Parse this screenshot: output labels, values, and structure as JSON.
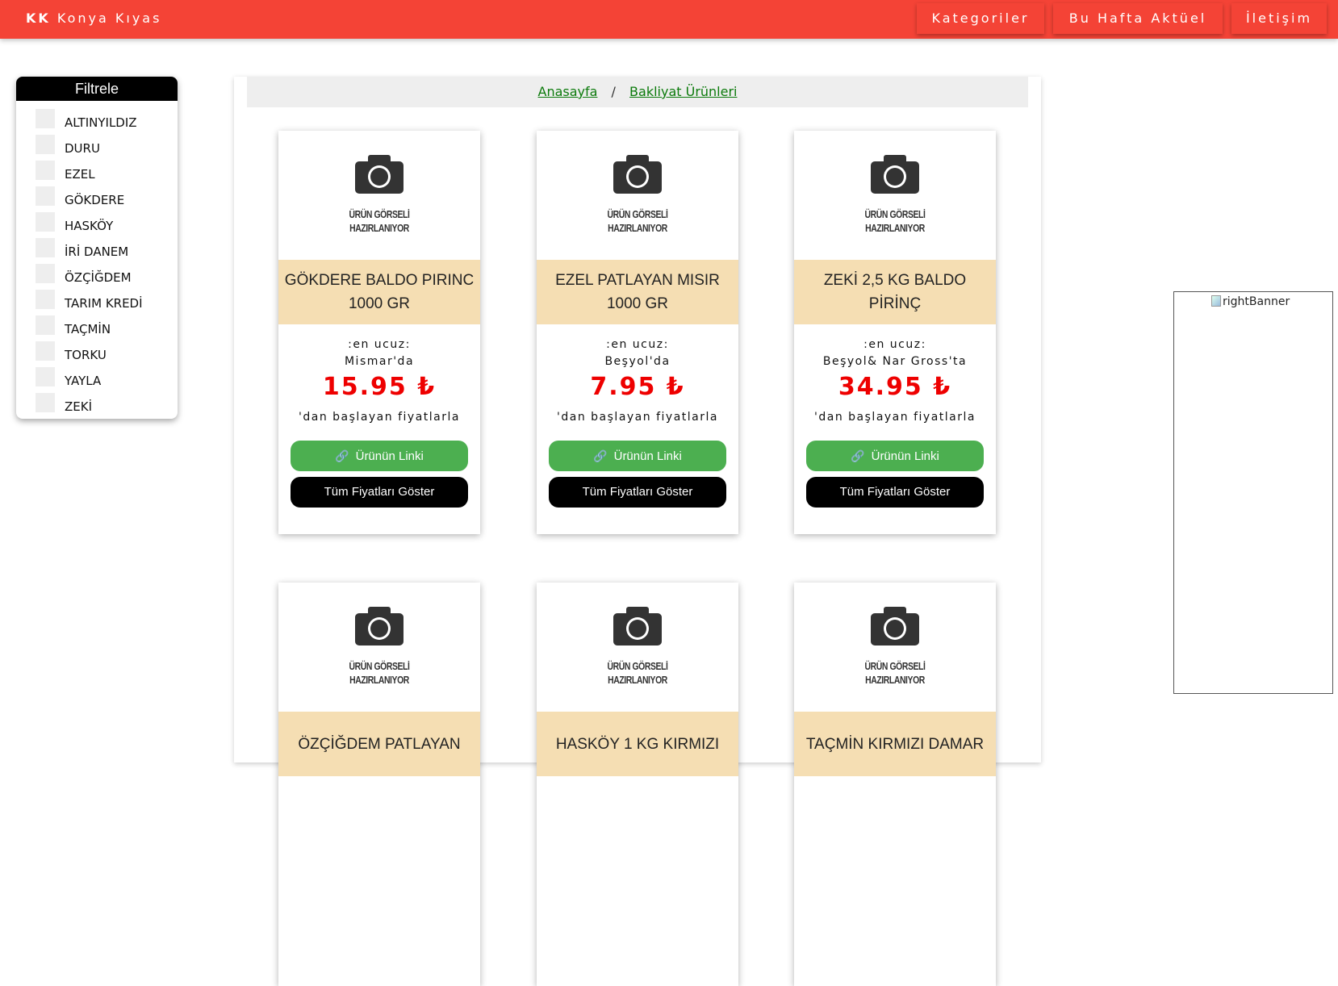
{
  "navbar": {
    "brand_short": "KK",
    "brand_name": "Konya Kıyas",
    "links": [
      "Kategoriler",
      "Bu Hafta Aktüel",
      "İletişim"
    ]
  },
  "filter": {
    "title": "Filtrele",
    "items": [
      "ALTINYILDIZ",
      "DURU",
      "EZEL",
      "GÖKDERE",
      "HASKÖY",
      "İRİ DANEM",
      "ÖZÇİĞDEM",
      "TARIM KREDİ",
      "TAÇMİN",
      "TORKU",
      "YAYLA",
      "ZEKİ"
    ]
  },
  "breadcrumb": {
    "home": "Anasayfa",
    "separator": "/",
    "current": "Bakliyat Ürünleri"
  },
  "placeholder_text": {
    "line1": "ÜRÜN GÖRSELİ",
    "line2": "HAZIRLANIYOR"
  },
  "product_labels": {
    "cheapest": ":en ucuz:",
    "from_suffix": "'dan başlayan fiyatlarla",
    "link_button": "Ürünün Linki",
    "all_prices_button": "Tüm Fiyatları Göster"
  },
  "products": [
    {
      "title": "GÖKDERE BALDO PIRINC 1000 GR",
      "store": "Mismar'da",
      "price": "15.95 ₺"
    },
    {
      "title": "EZEL PATLAYAN MISIR 1000 GR",
      "store": "Beşyol'da",
      "price": "7.95 ₺"
    },
    {
      "title": "ZEKİ 2,5 KG BALDO PİRİNÇ",
      "store": "Beşyol& Nar Gross'ta",
      "price": "34.95 ₺"
    },
    {
      "title": "ÖZÇİĞDEM PATLAYAN",
      "store": "",
      "price": ""
    },
    {
      "title": "HASKÖY 1 KG KIRMIZI",
      "store": "",
      "price": ""
    },
    {
      "title": "TAÇMİN KIRMIZI DAMAR",
      "store": "",
      "price": ""
    }
  ],
  "banner": {
    "alt_text": "rightBanner"
  },
  "colors": {
    "navbar": "#f44336",
    "price": "#ee0000",
    "title_bg": "#f5deb3",
    "link_button": "#4caf50",
    "breadcrumb_link": "#0b7a0b"
  }
}
